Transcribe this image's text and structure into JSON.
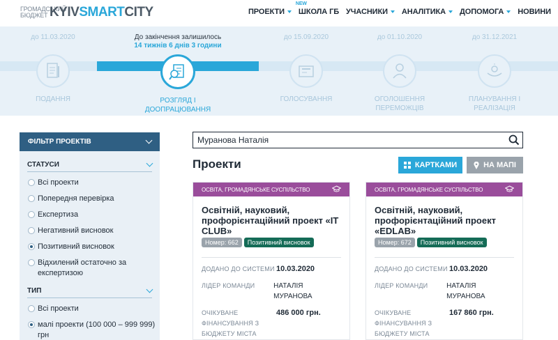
{
  "header": {
    "logo_small": "ГРОМАДСЬКИЙ БЮДЖЕТ",
    "logo_brand_a": "KYIV",
    "logo_brand_b": "SMART",
    "logo_brand_c": "CITY",
    "new_badge": "NEW",
    "nav": [
      {
        "label": "ПРОЕКТИ",
        "dropdown": true
      },
      {
        "label": "ШКОЛА ГБ",
        "dropdown": false
      },
      {
        "label": "УЧАСНИКИ",
        "dropdown": true
      },
      {
        "label": "АНАЛІТИКА",
        "dropdown": true
      },
      {
        "label": "ДОПОМОГА",
        "dropdown": true
      },
      {
        "label": "НОВИНИ",
        "dropdown": false
      }
    ]
  },
  "timeline": {
    "stages": [
      {
        "date": "до 11.03.2020",
        "label": "ПОДАННЯ",
        "icon": "document-pen-icon"
      },
      {
        "date": "До закінчення залишилось",
        "countdown": "14 тижнів 6 днів 3 години",
        "label": "РОЗГЛЯД І ДООПРАЦЮВАННЯ",
        "icon": "magnifier-checklist-icon",
        "active": true
      },
      {
        "date": "до 15.09.2020",
        "label": "ГОЛОСУВАННЯ",
        "icon": "ballot-icon"
      },
      {
        "date": "до 01.10.2020",
        "label": "ОГОЛОШЕННЯ ПЕРЕМОЖЦІВ",
        "icon": "winner-icon"
      },
      {
        "date": "до 31.12.2021",
        "label": "ПЛАНУВАННЯ І РЕАЛІЗАЦІЯ",
        "icon": "hands-icon"
      }
    ]
  },
  "sidebar": {
    "filter_title": "ФІЛЬТР ПРОЕКТІВ",
    "statuses_title": "СТАТУСИ",
    "statuses": [
      {
        "label": "Всі проекти",
        "checked": false
      },
      {
        "label": "Попередня перевірка",
        "checked": false
      },
      {
        "label": "Експертиза",
        "checked": false
      },
      {
        "label": "Негативний висновок",
        "checked": false
      },
      {
        "label": "Позитивний висновок",
        "checked": true
      },
      {
        "label": "Відхилений остаточно за експертизою",
        "checked": false
      }
    ],
    "type_title": "ТИП",
    "types": [
      {
        "label": "Всі проекти",
        "checked": false
      },
      {
        "label": "малі проекти (100 000 – 999 999) грн",
        "checked": true
      }
    ]
  },
  "search": {
    "value": "Муранова Наталія"
  },
  "main": {
    "title": "Проекти",
    "btn_cards": "КАРТКАМИ",
    "btn_map": "НА МАПІ"
  },
  "cards": [
    {
      "category": "ОСВІТА, ГРОМАДЯНСЬКЕ СУСПІЛЬСТВО",
      "title": "Освітній, науковий, профорієнтаційний проект «IT CLUB»",
      "number": "Номер: 662",
      "status": "Позитивний висновок",
      "added_label": "ДОДАНО ДО СИСТЕМИ",
      "added_value": "10.03.2020",
      "leader_label": "ЛІДЕР КОМАНДИ",
      "leader_value": "НАТАЛІЯ МУРАНОВА",
      "budget_label": "ОЧІКУВАНЕ ФІНАНСУВАННЯ З БЮДЖЕТУ МІСТА КИЄВА",
      "budget_value": "486 000 грн."
    },
    {
      "category": "ОСВІТА, ГРОМАДЯНСЬКЕ СУСПІЛЬСТВО",
      "title": "Освітній, науковий, профорієнтаційний проект «EDLAB»",
      "number": "Номер: 672",
      "status": "Позитивний висновок",
      "added_label": "ДОДАНО ДО СИСТЕМИ",
      "added_value": "10.03.2020",
      "leader_label": "ЛІДЕР КОМАНДИ",
      "leader_value": "НАТАЛІЯ МУРАНОВА",
      "budget_label": "ОЧІКУВАНЕ ФІНАНСУВАННЯ З БЮДЖЕТУ МІСТА КИЄВА",
      "budget_value": "167 860 грн."
    }
  ],
  "colors": {
    "accent": "#2aa7d9",
    "filter_head": "#2f5f83",
    "category": "#9a4d9b",
    "status_tag": "#146b56"
  }
}
